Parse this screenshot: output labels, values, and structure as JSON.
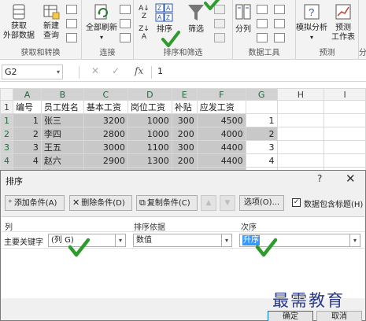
{
  "ribbon": {
    "get_external_data": "获取\n外部数据",
    "new_query": "新建\n查询",
    "group_get_transform": "获取和转换",
    "refresh_all": "全部刷新",
    "group_connections": "连接",
    "sort_az": "A↓Z",
    "sort": "排序",
    "filter": "筛选",
    "group_sort_filter": "排序和筛选",
    "text_to_columns": "分列",
    "group_data_tools": "数据工具",
    "what_if": "模拟分析",
    "forecast_sheet": "预测\n工作表",
    "group_forecast": "预测",
    "clipped_label": "分"
  },
  "formula_bar": {
    "name_box": "G2",
    "fx": "fx",
    "value": "1"
  },
  "sheet": {
    "columns": [
      "A",
      "B",
      "C",
      "D",
      "E",
      "F",
      "G",
      "H",
      "I"
    ],
    "headers": [
      "编号",
      "员工姓名",
      "基本工资",
      "岗位工资",
      "补贴",
      "应发工资",
      ""
    ],
    "rows": [
      {
        "num": "1",
        "cells": [
          "1",
          "张三",
          "3200",
          "1000",
          "300",
          "4500",
          "1"
        ]
      },
      {
        "num": "2",
        "cells": [
          "2",
          "李四",
          "2800",
          "1000",
          "200",
          "4000",
          "2"
        ]
      },
      {
        "num": "3",
        "cells": [
          "3",
          "王五",
          "3000",
          "1100",
          "300",
          "4400",
          "3"
        ]
      },
      {
        "num": "4",
        "cells": [
          "4",
          "赵六",
          "2900",
          "1300",
          "200",
          "4400",
          "4"
        ]
      },
      {
        "num": "5",
        "cells": [
          "5",
          "朱七",
          "3500",
          "1100",
          "300",
          "4900",
          "5"
        ]
      }
    ]
  },
  "dialog": {
    "title": "排序",
    "help": "?",
    "close": "✕",
    "add_level": "添加条件(A)",
    "delete_level": "删除条件(D)",
    "copy_level": "复制条件(C)",
    "move_up": "▲",
    "move_down": "▼",
    "options": "选项(O)...",
    "header_checkbox_checked": true,
    "header_checkbox_label": "数据包含标题(H)",
    "col_header_column": "列",
    "col_header_sort_on": "排序依据",
    "col_header_order": "次序",
    "row_label": "主要关键字",
    "column_value": "(列 G)",
    "sort_on_value": "数值",
    "order_value": "升序",
    "ok": "确定",
    "cancel": "取消"
  },
  "watermark": "最需教育",
  "colors": {
    "check_green": "#2e9b2e",
    "selection_gray": "#c8c8c8",
    "highlight_blue": "#3399ff",
    "watermark_blue": "#2b3a8c"
  }
}
